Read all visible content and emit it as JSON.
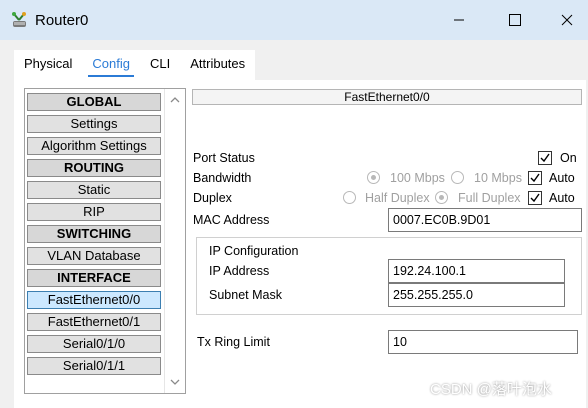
{
  "window": {
    "title": "Router0",
    "app_icon": "router-icon",
    "controls": [
      "minimize-icon",
      "maximize-icon",
      "close-icon"
    ]
  },
  "tabs": [
    {
      "label": "Physical",
      "active": false
    },
    {
      "label": "Config",
      "active": true
    },
    {
      "label": "CLI",
      "active": false
    },
    {
      "label": "Attributes",
      "active": false
    }
  ],
  "sidebar": {
    "items": [
      {
        "label": "GLOBAL",
        "type": "header"
      },
      {
        "label": "Settings",
        "type": "item"
      },
      {
        "label": "Algorithm Settings",
        "type": "item"
      },
      {
        "label": "ROUTING",
        "type": "header"
      },
      {
        "label": "Static",
        "type": "item"
      },
      {
        "label": "RIP",
        "type": "item"
      },
      {
        "label": "SWITCHING",
        "type": "header"
      },
      {
        "label": "VLAN Database",
        "type": "item"
      },
      {
        "label": "INTERFACE",
        "type": "header"
      },
      {
        "label": "FastEthernet0/0",
        "type": "item",
        "selected": true
      },
      {
        "label": "FastEthernet0/1",
        "type": "item"
      },
      {
        "label": "Serial0/1/0",
        "type": "item"
      },
      {
        "label": "Serial0/1/1",
        "type": "item"
      }
    ]
  },
  "interface": {
    "title": "FastEthernet0/0",
    "port_status": {
      "label": "Port Status",
      "on_label": "On",
      "on": true
    },
    "bandwidth": {
      "label": "Bandwidth",
      "options": [
        "100 Mbps",
        "10 Mbps"
      ],
      "selected": "100 Mbps",
      "auto_label": "Auto",
      "auto": true
    },
    "duplex": {
      "label": "Duplex",
      "options": [
        "Half Duplex",
        "Full Duplex"
      ],
      "selected": "Full Duplex",
      "auto_label": "Auto",
      "auto": true
    },
    "mac": {
      "label": "MAC Address",
      "value": "0007.EC0B.9D01"
    },
    "ip_config": {
      "title": "IP Configuration",
      "ip_label": "IP Address",
      "ip_value": "192.24.100.1",
      "mask_label": "Subnet Mask",
      "mask_value": "255.255.255.0"
    },
    "tx_ring": {
      "label": "Tx Ring Limit",
      "value": "10"
    }
  },
  "watermark": "CSDN @落叶泡水",
  "colors": {
    "accent": "#2b7bd6",
    "titlebar": "#dae8f6",
    "selected_item": "#cce8ff"
  }
}
